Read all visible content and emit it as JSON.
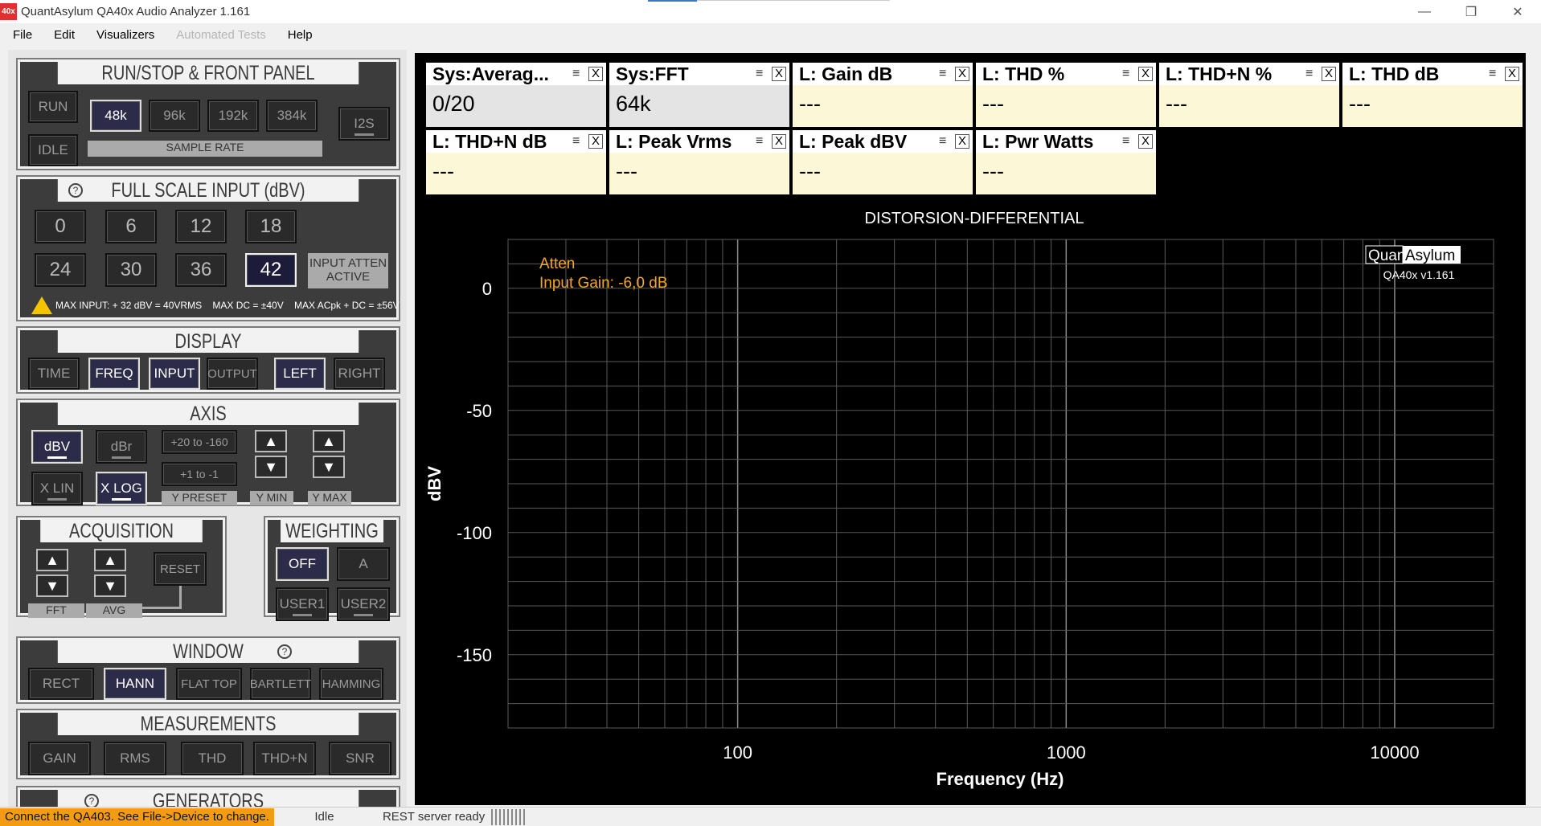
{
  "window": {
    "icon_text": "40x",
    "title": "QuantAsylum QA40x Audio Analyzer 1.161",
    "controls": [
      "—",
      "❐",
      "✕"
    ]
  },
  "menu": [
    "File",
    "Edit",
    "Visualizers",
    "Automated Tests",
    "Help"
  ],
  "run_stop": {
    "title": "RUN/STOP & FRONT PANEL",
    "run": "RUN",
    "idle": "IDLE",
    "rates": [
      "48k",
      "96k",
      "192k",
      "384k"
    ],
    "selected_rate": "48k",
    "rate_label": "SAMPLE RATE",
    "i2s": "I2S"
  },
  "full_scale": {
    "title": "FULL SCALE INPUT (dBV)",
    "help": "?",
    "values": [
      "0",
      "6",
      "12",
      "18",
      "24",
      "30",
      "36",
      "42"
    ],
    "selected": "42",
    "atten_label": "INPUT ATTEN ACTIVE",
    "warning": "MAX INPUT: + 32 dBV = 40VRMS    MAX DC = ±40V    MAX ACpk + DC = ±56V"
  },
  "display": {
    "title": "DISPLAY",
    "buttons": [
      "TIME",
      "FREQ",
      "INPUT",
      "OUTPUT",
      "LEFT",
      "RIGHT"
    ],
    "active": [
      "FREQ",
      "INPUT",
      "LEFT"
    ]
  },
  "axis": {
    "title": "AXIS",
    "dbv": "dBV",
    "dbr": "dBr",
    "xlin": "X LIN",
    "xlog": "X LOG",
    "preset1": "+20 to -160",
    "preset2": "+1 to -1",
    "y_preset": "Y PRESET",
    "y_min": "Y MIN",
    "y_max": "Y MAX",
    "up": "▲",
    "down": "▼"
  },
  "acquisition": {
    "title": "ACQUISITION",
    "reset": "RESET",
    "fft": "FFT",
    "avg": "AVG"
  },
  "weighting": {
    "title": "WEIGHTING",
    "buttons": [
      "OFF",
      "A",
      "USER1",
      "USER2"
    ],
    "active": "OFF"
  },
  "window_fn": {
    "title": "WINDOW",
    "help": "?",
    "buttons": [
      "RECT",
      "HANN",
      "FLAT TOP",
      "BARTLETT",
      "HAMMING"
    ],
    "active": "HANN"
  },
  "measurements": {
    "title": "MEASUREMENTS",
    "buttons": [
      "GAIN",
      "RMS",
      "THD",
      "THD+N",
      "SNR"
    ]
  },
  "generators": {
    "title": "GENERATORS",
    "help": "?"
  },
  "widgets": [
    {
      "title": "Sys:Averag...",
      "value": "0/20",
      "kind": "sys"
    },
    {
      "title": "Sys:FFT",
      "value": "64k",
      "kind": "sys"
    },
    {
      "title": "L: Gain dB",
      "value": "---",
      "kind": "meas"
    },
    {
      "title": "L: THD %",
      "value": "---",
      "kind": "meas"
    },
    {
      "title": "L: THD+N %",
      "value": "---",
      "kind": "meas"
    },
    {
      "title": "L: THD dB",
      "value": "---",
      "kind": "meas"
    },
    {
      "title": "L: THD+N dB",
      "value": "---",
      "kind": "meas"
    },
    {
      "title": "L: Peak Vrms",
      "value": "---",
      "kind": "meas"
    },
    {
      "title": "L: Peak dBV",
      "value": "---",
      "kind": "meas"
    },
    {
      "title": "L: Pwr Watts",
      "value": "---",
      "kind": "meas"
    }
  ],
  "widget_icons": {
    "menu": "≡",
    "close": "X"
  },
  "chart_data": {
    "type": "line",
    "title": "DISTORSION-DIFFERENTIAL",
    "xlabel": "Frequency (Hz)",
    "ylabel": "dBV",
    "x_scale": "log",
    "xlim": [
      20,
      20000
    ],
    "ylim": [
      -180,
      20
    ],
    "x_ticks": [
      100,
      1000,
      10000
    ],
    "x_tick_labels": [
      "100",
      "1000",
      "10000"
    ],
    "y_ticks": [
      0,
      -50,
      -100,
      -150
    ],
    "y_tick_labels": [
      "0",
      "-50",
      "-100",
      "-150"
    ],
    "grid": true,
    "series": [],
    "annotations": [
      "Atten",
      "Input Gain: -6,0 dB"
    ],
    "watermark": {
      "brand_left": "Quant",
      "brand_right": "Asylum",
      "version": "QA40x v1.161"
    },
    "colors": {
      "background": "#000000",
      "grid": "#5a5a5a",
      "annotation": "#f5a623",
      "text": "#ffffff"
    }
  },
  "status": {
    "message": "Connect the QA403. See File->Device to change.",
    "state": "Idle",
    "server": "REST server ready"
  }
}
